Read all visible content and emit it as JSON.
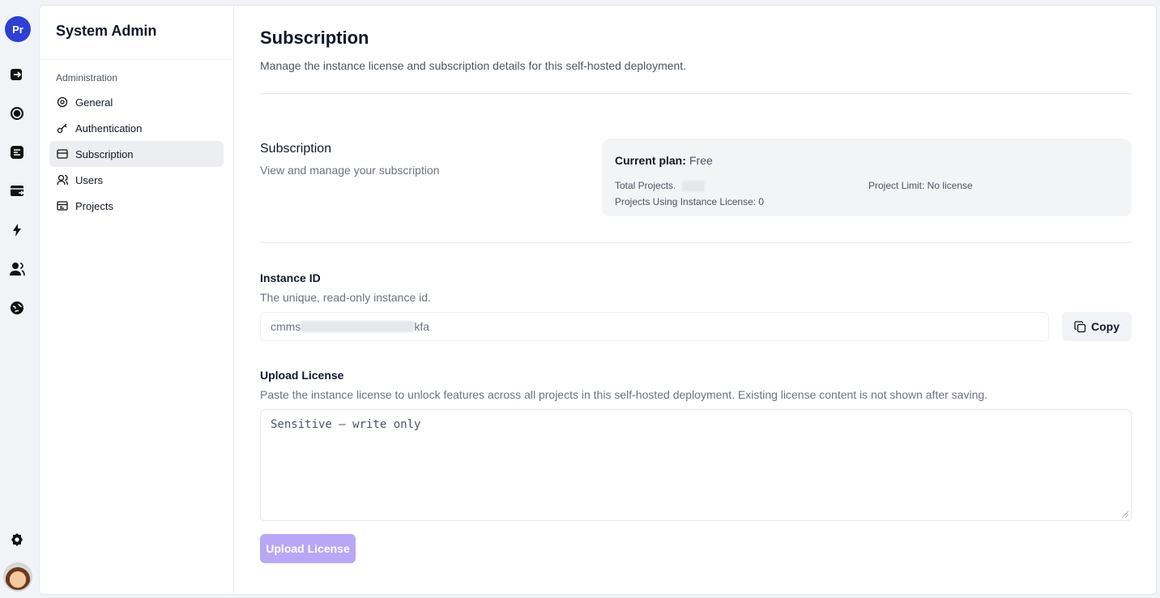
{
  "rail": {
    "project_initials": "Pr",
    "icons": [
      "import-icon",
      "record-icon",
      "board-icon",
      "deploy-icon",
      "bolt-icon",
      "users-icon",
      "globe-icon",
      "settings-icon"
    ]
  },
  "sidebar": {
    "title": "System Admin",
    "section": "Administration",
    "items": [
      {
        "label": "General",
        "icon": "gear-icon"
      },
      {
        "label": "Authentication",
        "icon": "key-icon"
      },
      {
        "label": "Subscription",
        "icon": "card-icon",
        "active": true
      },
      {
        "label": "Users",
        "icon": "users-icon"
      },
      {
        "label": "Projects",
        "icon": "projects-icon"
      }
    ]
  },
  "page": {
    "title": "Subscription",
    "description": "Manage the instance license and subscription details for this self-hosted deployment."
  },
  "subscription": {
    "title": "Subscription",
    "description": "View and manage your subscription",
    "current_plan_label": "Current plan:",
    "current_plan_value": "Free",
    "total_projects_label": "Total Projects.",
    "project_limit": "Project Limit: No license",
    "projects_using_license": "Projects Using Instance License: 0"
  },
  "instance": {
    "label": "Instance ID",
    "help": "The unique, read-only instance id.",
    "id_prefix": "cmms",
    "id_suffix": "kfa",
    "copy_label": "Copy"
  },
  "license": {
    "label": "Upload License",
    "help": "Paste the instance license to unlock features across all projects in this self-hosted deployment. Existing license content is not shown after saving.",
    "placeholder": "Sensitive — write only",
    "button_label": "Upload License"
  },
  "colors": {
    "accent_disabled": "#b9a6f7",
    "project_badge": "#2e3fd6"
  }
}
